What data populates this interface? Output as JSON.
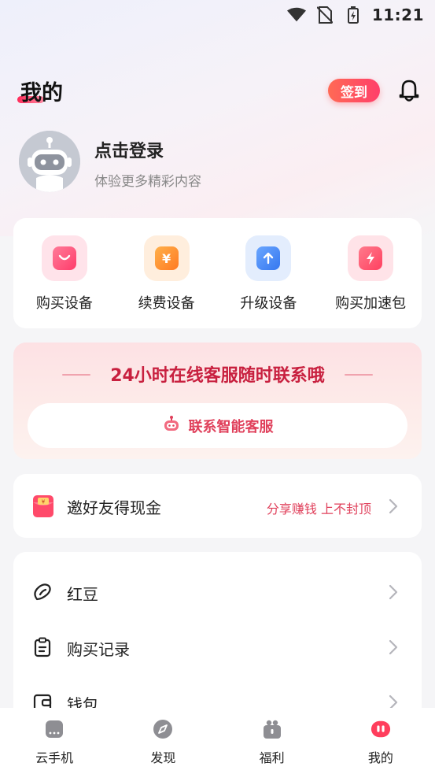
{
  "status_bar": {
    "time": "11:21"
  },
  "header": {
    "title": "我的",
    "checkin_label": "签到"
  },
  "profile": {
    "login_title": "点击登录",
    "login_subtitle": "体验更多精彩内容"
  },
  "quick_actions": [
    {
      "label": "购买设备",
      "icon": "shopping-bag-icon",
      "color": "#ff4f7a"
    },
    {
      "label": "续费设备",
      "icon": "yuan-icon",
      "color": "#ff8a2b"
    },
    {
      "label": "升级设备",
      "icon": "upgrade-arrow-icon",
      "color": "#3f86f5"
    },
    {
      "label": "购买加速包",
      "icon": "lightning-icon",
      "color": "#ff4f6d"
    }
  ],
  "service": {
    "title": "24小时在线客服随时联系哦",
    "button_label": "联系智能客服"
  },
  "invite": {
    "label": "邀好友得现金",
    "promo": "分享赚钱 上不封顶"
  },
  "menu": [
    {
      "label": "红豆",
      "icon": "bean-icon"
    },
    {
      "label": "购买记录",
      "icon": "clipboard-icon"
    },
    {
      "label": "钱包",
      "icon": "wallet-icon"
    }
  ],
  "tabbar": {
    "items": [
      {
        "label": "云手机",
        "icon": "cloud-phone-icon"
      },
      {
        "label": "发现",
        "icon": "compass-icon"
      },
      {
        "label": "福利",
        "icon": "gift-icon"
      },
      {
        "label": "我的",
        "icon": "profile-icon",
        "active": true
      }
    ]
  },
  "colors": {
    "accent": "#e0405b",
    "service_title": "#c8203f"
  }
}
